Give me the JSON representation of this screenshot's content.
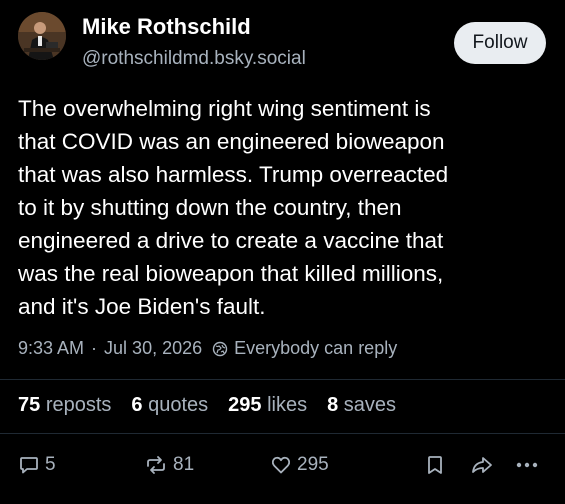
{
  "author": {
    "display_name": "Mike Rothschild",
    "handle": "@rothschildmd.bsky.social"
  },
  "follow_label": "Follow",
  "post": {
    "text": "The overwhelming right wing sentiment is\nthat COVID was an engineered bioweapon\nthat was also harmless. Trump overreacted\nto it by shutting down the country, then\nengineered a drive to create a vaccine that\nwas the real bioweapon that killed millions,\nand it's Joe Biden's fault.",
    "time": "9:33 AM",
    "separator": "·",
    "date": "Jul 30, 2026",
    "reply_setting": "Everybody can reply"
  },
  "stats": {
    "reposts": {
      "count": "75",
      "label": "reposts"
    },
    "quotes": {
      "count": "6",
      "label": "quotes"
    },
    "likes": {
      "count": "295",
      "label": "likes"
    },
    "saves": {
      "count": "8",
      "label": "saves"
    }
  },
  "actions": {
    "reply_count": "5",
    "repost_count": "81",
    "like_count": "295"
  },
  "icons": [
    "globe-icon",
    "reply-icon",
    "repost-icon",
    "heart-icon",
    "bookmark-icon",
    "share-icon",
    "more-icon"
  ],
  "colors": {
    "background": "#000000",
    "text": "#ffffff",
    "muted": "#a8b2bd",
    "follow_bg": "#e9edf1"
  }
}
